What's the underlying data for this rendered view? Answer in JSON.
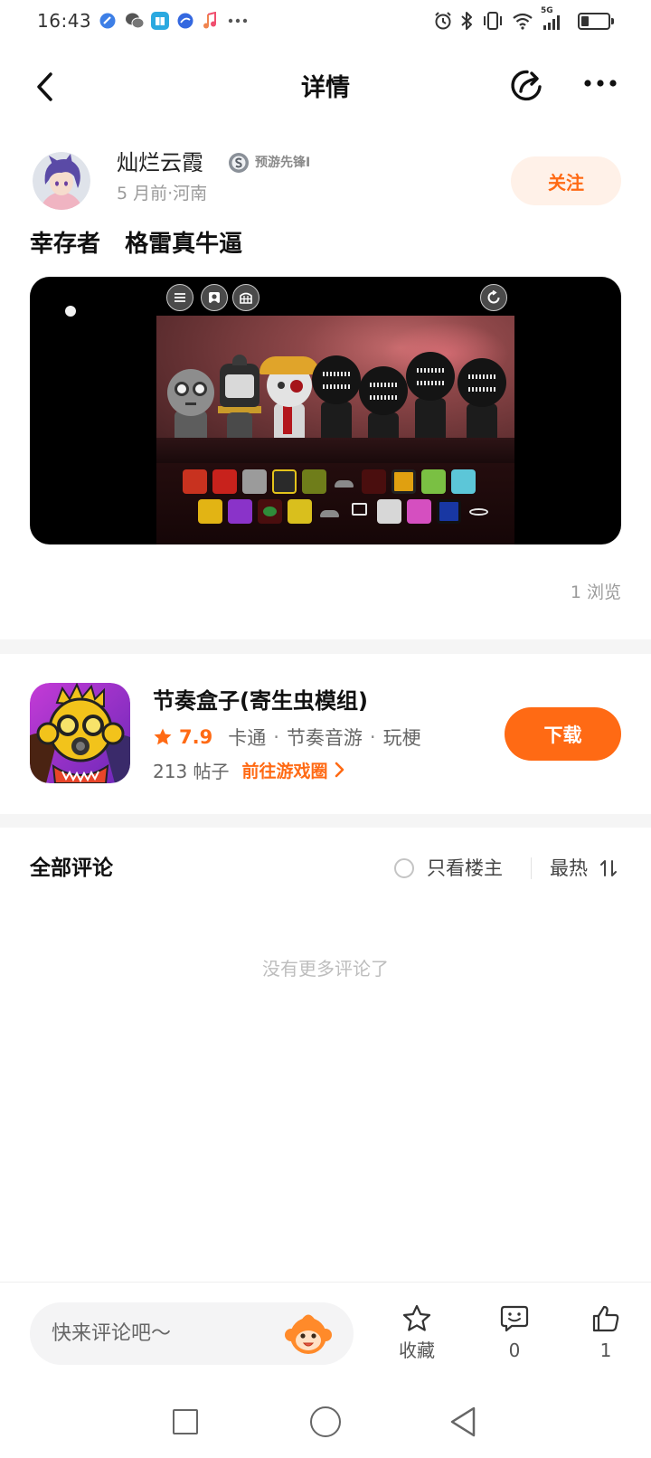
{
  "theme": {
    "accent": "#ff6a14",
    "accent_soft": "#fff1e8"
  },
  "status_bar": {
    "time": "16:43",
    "notification_icons": [
      "app-icon",
      "wechat-icon",
      "book-app-icon",
      "app-icon",
      "music-icon",
      "more-icon"
    ],
    "system_icons": [
      "alarm-icon",
      "bluetooth-icon",
      "vibrate-icon",
      "wifi-icon",
      "signal-icon",
      "battery-icon"
    ],
    "network": "5G",
    "battery_level": 0.3
  },
  "header": {
    "title": "详情",
    "icons": [
      "chevron-left-icon",
      "share-icon",
      "more-icon"
    ]
  },
  "post": {
    "author": {
      "name": "灿烂云霞",
      "badge": "预游先锋I",
      "meta": "5 月前·河南"
    },
    "follow_label": "关注",
    "title": "幸存者   格雷真牛逼",
    "media_controls": [
      "menu-icon",
      "portrait-icon",
      "grid-icon",
      "reset-icon"
    ],
    "views": "1 浏览"
  },
  "game_card": {
    "name": "节奏盒子(寄生虫模组)",
    "rating": "7.9",
    "tags": [
      "卡通",
      "节奏音游",
      "玩梗"
    ],
    "tag_separator": "·",
    "posts": "213 帖子",
    "circle_link": "前往游戏圈",
    "download_label": "下载"
  },
  "comments": {
    "title": "全部评论",
    "owner_only_label": "只看楼主",
    "owner_only_checked": false,
    "sort_label": "最热",
    "empty_text": "没有更多评论了"
  },
  "bottom_bar": {
    "input_placeholder": "快来评论吧～",
    "favorite_label": "收藏",
    "comment_count": "0",
    "like_count": "1"
  },
  "nav_bar": {
    "icons": [
      "recent-apps-icon",
      "home-icon",
      "back-icon"
    ]
  }
}
